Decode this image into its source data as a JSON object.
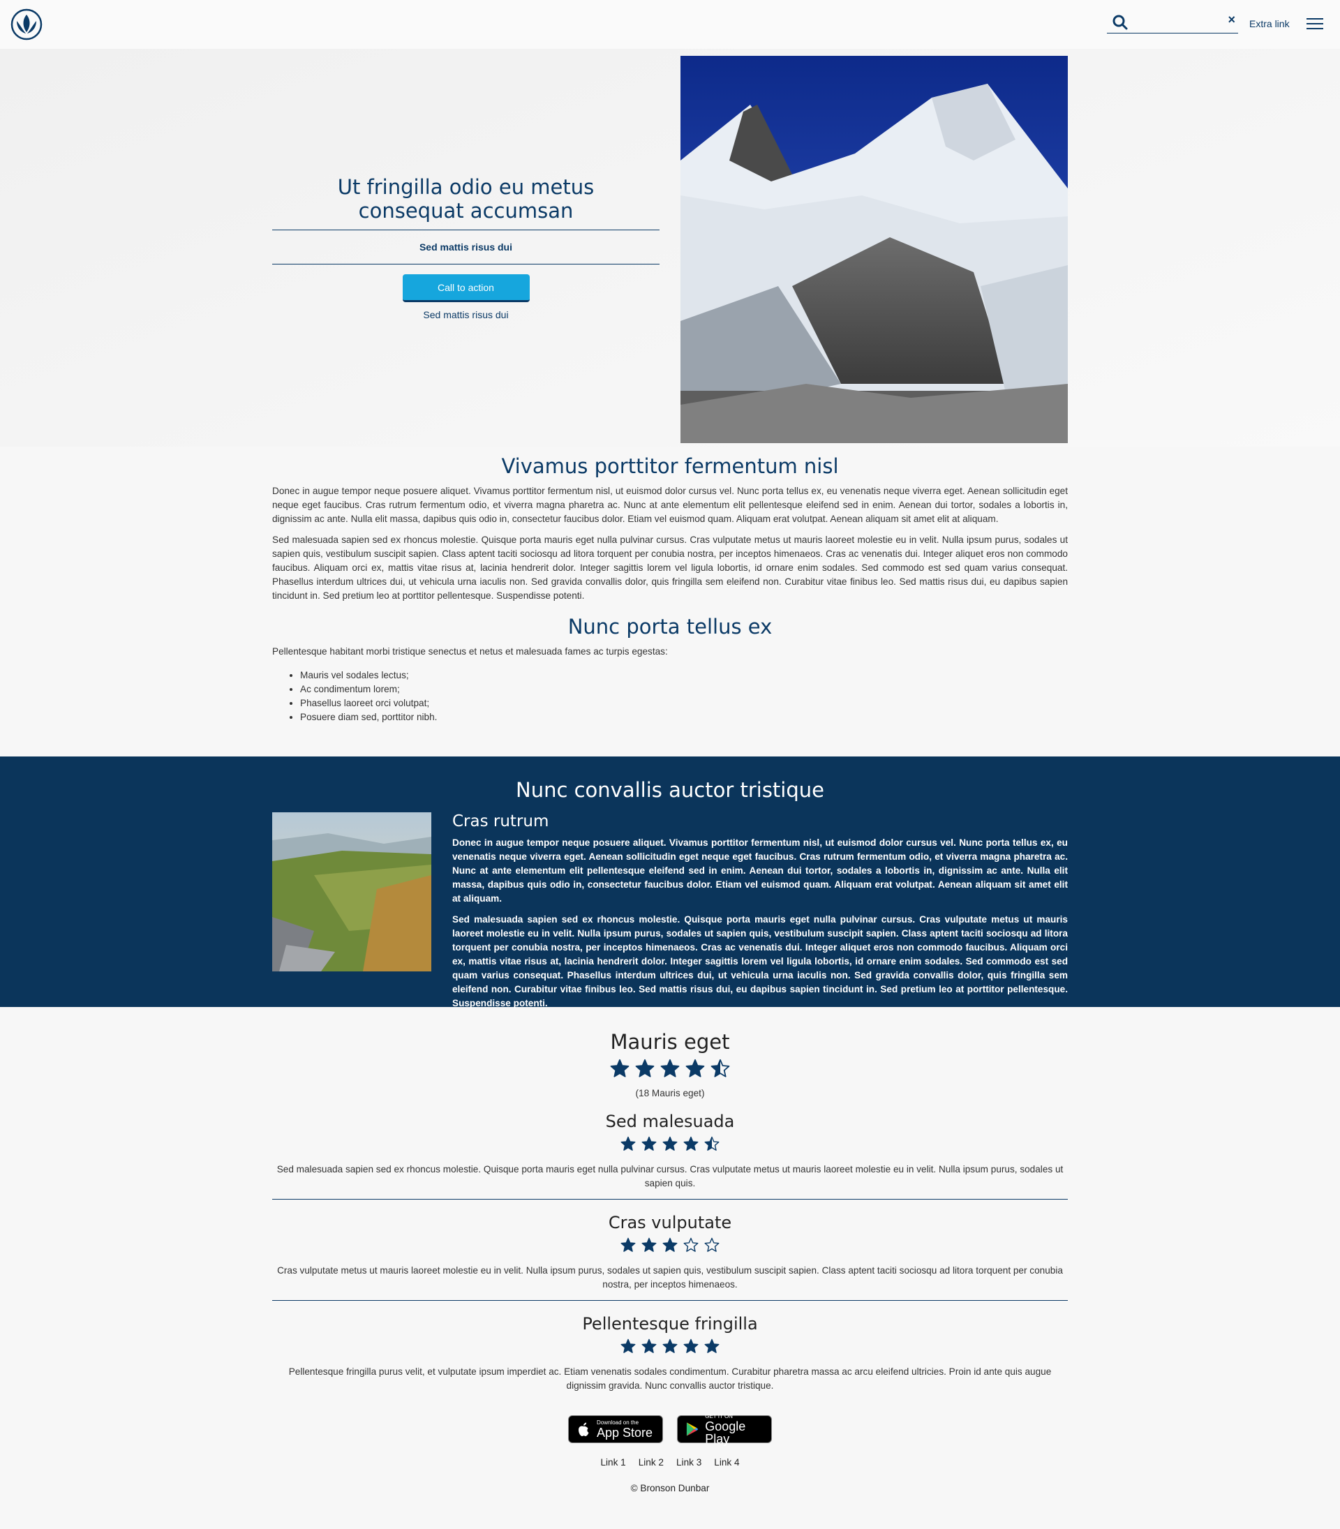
{
  "header": {
    "search_placeholder": "",
    "search_value": "",
    "clear_label": "×",
    "extra_link": "Extra link"
  },
  "hero": {
    "title": "Ut fringilla odio eu metus consequat accumsan",
    "subtitle": "Sed mattis risus dui",
    "cta_label": "Call to action",
    "note": "Sed mattis risus dui"
  },
  "article": {
    "title": "Vivamus porttitor fermentum nisl",
    "paragraphs": [
      "Donec in augue tempor neque posuere aliquet. Vivamus porttitor fermentum nisl, ut euismod dolor cursus vel. Nunc porta tellus ex, eu venenatis neque viverra eget. Aenean sollicitudin eget neque eget faucibus. Cras rutrum fermentum odio, et viverra magna pharetra ac. Nunc at ante elementum elit pellentesque eleifend sed in enim. Aenean dui tortor, sodales a lobortis in, dignissim ac ante. Nulla elit massa, dapibus quis odio in, consectetur faucibus dolor. Etiam vel euismod quam. Aliquam erat volutpat. Aenean aliquam sit amet elit at aliquam.",
      "Sed malesuada sapien sed ex rhoncus molestie. Quisque porta mauris eget nulla pulvinar cursus. Cras vulputate metus ut mauris laoreet molestie eu in velit. Nulla ipsum purus, sodales ut sapien quis, vestibulum suscipit sapien. Class aptent taciti sociosqu ad litora torquent per conubia nostra, per inceptos himenaeos. Cras ac venenatis dui. Integer aliquet eros non commodo faucibus. Aliquam orci ex, mattis vitae risus at, lacinia hendrerit dolor. Integer sagittis lorem vel ligula lobortis, id ornare enim sodales. Sed commodo est sed quam varius consequat. Phasellus interdum ultrices dui, ut vehicula urna iaculis non. Sed gravida convallis dolor, quis fringilla sem eleifend non. Curabitur vitae finibus leo. Sed mattis risus dui, eu dapibus sapien tincidunt in. Sed pretium leo at porttitor pellentesque. Suspendisse potenti."
    ]
  },
  "section2": {
    "title": "Nunc porta tellus ex",
    "intro": "Pellentesque habitant morbi tristique senectus et netus et malesuada fames ac turpis egestas:",
    "list": [
      "Mauris vel sodales lectus;",
      "Ac condimentum lorem;",
      "Phasellus laoreet orci volutpat;",
      "Posuere diam sed, porttitor nibh."
    ]
  },
  "band": {
    "title": "Nunc convallis auctor tristique",
    "subtitle": "Cras rutrum",
    "paragraphs": [
      "Donec in augue tempor neque posuere aliquet. Vivamus porttitor fermentum nisl, ut euismod dolor cursus vel. Nunc porta tellus ex, eu venenatis neque viverra eget. Aenean sollicitudin eget neque eget faucibus. Cras rutrum fermentum odio, et viverra magna pharetra ac. Nunc at ante elementum elit pellentesque eleifend sed in enim. Aenean dui tortor, sodales a lobortis in, dignissim ac ante. Nulla elit massa, dapibus quis odio in, consectetur faucibus dolor. Etiam vel euismod quam. Aliquam erat volutpat. Aenean aliquam sit amet elit at aliquam.",
      "Sed malesuada sapien sed ex rhoncus molestie. Quisque porta mauris eget nulla pulvinar cursus. Cras vulputate metus ut mauris laoreet molestie eu in velit. Nulla ipsum purus, sodales ut sapien quis, vestibulum suscipit sapien. Class aptent taciti sociosqu ad litora torquent per conubia nostra, per inceptos himenaeos. Cras ac venenatis dui. Integer aliquet eros non commodo faucibus. Aliquam orci ex, mattis vitae risus at, lacinia hendrerit dolor. Integer sagittis lorem vel ligula lobortis, id ornare enim sodales. Sed commodo est sed quam varius consequat. Phasellus interdum ultrices dui, ut vehicula urna iaculis non. Sed gravida convallis dolor, quis fringilla sem eleifend non. Curabitur vitae finibus leo. Sed mattis risus dui, eu dapibus sapien tincidunt in. Sed pretium leo at porttitor pellentesque. Suspendisse potenti."
    ]
  },
  "reviews": {
    "title": "Mauris eget",
    "rating": 4.5,
    "count_text": "(18 Mauris eget)",
    "items": [
      {
        "title": "Sed malesuada",
        "rating": 4.5,
        "text": "Sed malesuada sapien sed ex rhoncus molestie. Quisque porta mauris eget nulla pulvinar cursus. Cras vulputate metus ut mauris laoreet molestie eu in velit. Nulla ipsum purus, sodales ut sapien quis."
      },
      {
        "title": "Cras vulputate",
        "rating": 3,
        "text": "Cras vulputate metus ut mauris laoreet molestie eu in velit. Nulla ipsum purus, sodales ut sapien quis, vestibulum suscipit sapien. Class aptent taciti sociosqu ad litora torquent per conubia nostra, per inceptos himenaeos."
      },
      {
        "title": "Pellentesque fringilla",
        "rating": 5,
        "text": "Pellentesque fringilla purus velit, et vulputate ipsum imperdiet ac. Etiam venenatis sodales condimentum. Curabitur pharetra massa ac arcu eleifend ultricies. Proin id ante quis augue dignissim gravida. Nunc convallis auctor tristique."
      }
    ]
  },
  "footer": {
    "appstore_small": "Download on the",
    "appstore_big": "App Store",
    "googleplay_small": "GET IT ON",
    "googleplay_big": "Google Play",
    "links": [
      "Link 1",
      "Link 2",
      "Link 3",
      "Link 4"
    ],
    "copyright": "© Bronson Dunbar"
  },
  "colors": {
    "primary": "#0b3a66",
    "accent": "#16a6dd",
    "band": "#0b355b",
    "star": "#0b3a66"
  },
  "icons": [
    "logo-icon",
    "search-icon",
    "close-icon",
    "hamburger-menu-icon",
    "star-icon",
    "apple-icon",
    "google-play-icon"
  ]
}
